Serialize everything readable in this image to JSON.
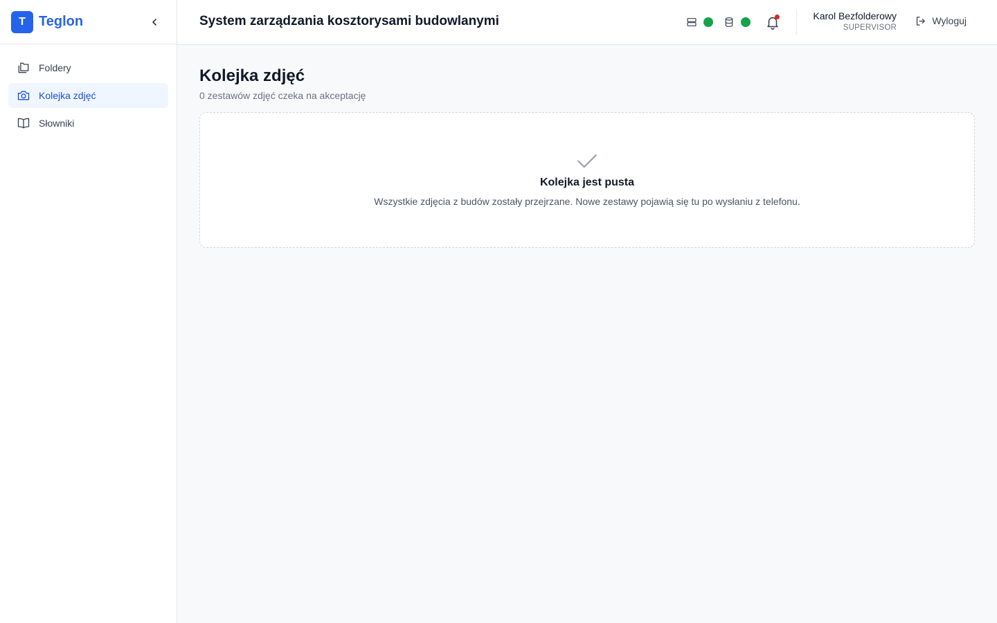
{
  "sidebar": {
    "logo_letter": "T",
    "brand": "Teglon",
    "items": [
      {
        "label": "Foldery",
        "icon": "folders-icon"
      },
      {
        "label": "Kolejka zdjęć",
        "icon": "camera-icon",
        "active": true
      },
      {
        "label": "Słowniki",
        "icon": "book-icon"
      }
    ]
  },
  "header": {
    "title": "System zarządzania kosztorysami budowlanymi",
    "status": [
      {
        "icon": "server-icon",
        "state_color": "#16a34a"
      },
      {
        "icon": "database-icon",
        "state_color": "#16a34a"
      }
    ],
    "notifications": {
      "icon": "bell-icon",
      "has_unread": true
    },
    "user": {
      "name": "Karol Bezfolderowy",
      "role": "SUPERVISOR"
    },
    "logout_label": "Wyloguj"
  },
  "main": {
    "title": "Kolejka zdjęć",
    "subtitle": "0 zestawów zdjęć czeka na akceptację",
    "empty": {
      "icon": "check-icon",
      "title": "Kolejka jest pusta",
      "description": "Wszystkie zdjęcia z budów zostały przejrzane. Nowe zestawy pojawią się tu po wysłaniu z telefonu."
    }
  },
  "colors": {
    "accent": "#2563eb",
    "status_ok": "#16a34a",
    "notification": "#dc2626"
  }
}
